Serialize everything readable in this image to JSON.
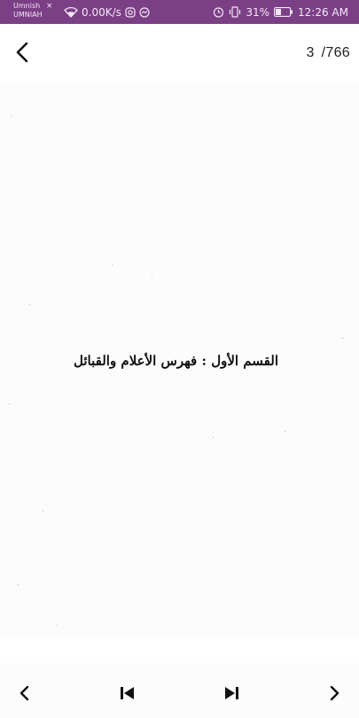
{
  "status_bar": {
    "app_line1": "Umnish",
    "app_line2": "UMNIAH",
    "close_glyph": "×",
    "network_speed": "0.00K/s",
    "battery_percent": "31%",
    "time": "12:26 AM",
    "bg_color": "#7b3f86",
    "icons": [
      "close-icon",
      "wifi-icon",
      "instagram-icon",
      "messenger-icon",
      "alarm-icon",
      "vibrate-icon",
      "battery-icon"
    ]
  },
  "app_bar": {
    "back_icon": "chevron-left-icon",
    "current_page": "3",
    "total_pages": "/766"
  },
  "page": {
    "heading": "القسم الأول : فهرس الأعلام والقبائل"
  },
  "bottom_nav": {
    "icons": [
      "prev-page-icon",
      "first-page-icon",
      "last-page-icon",
      "next-page-icon"
    ]
  }
}
